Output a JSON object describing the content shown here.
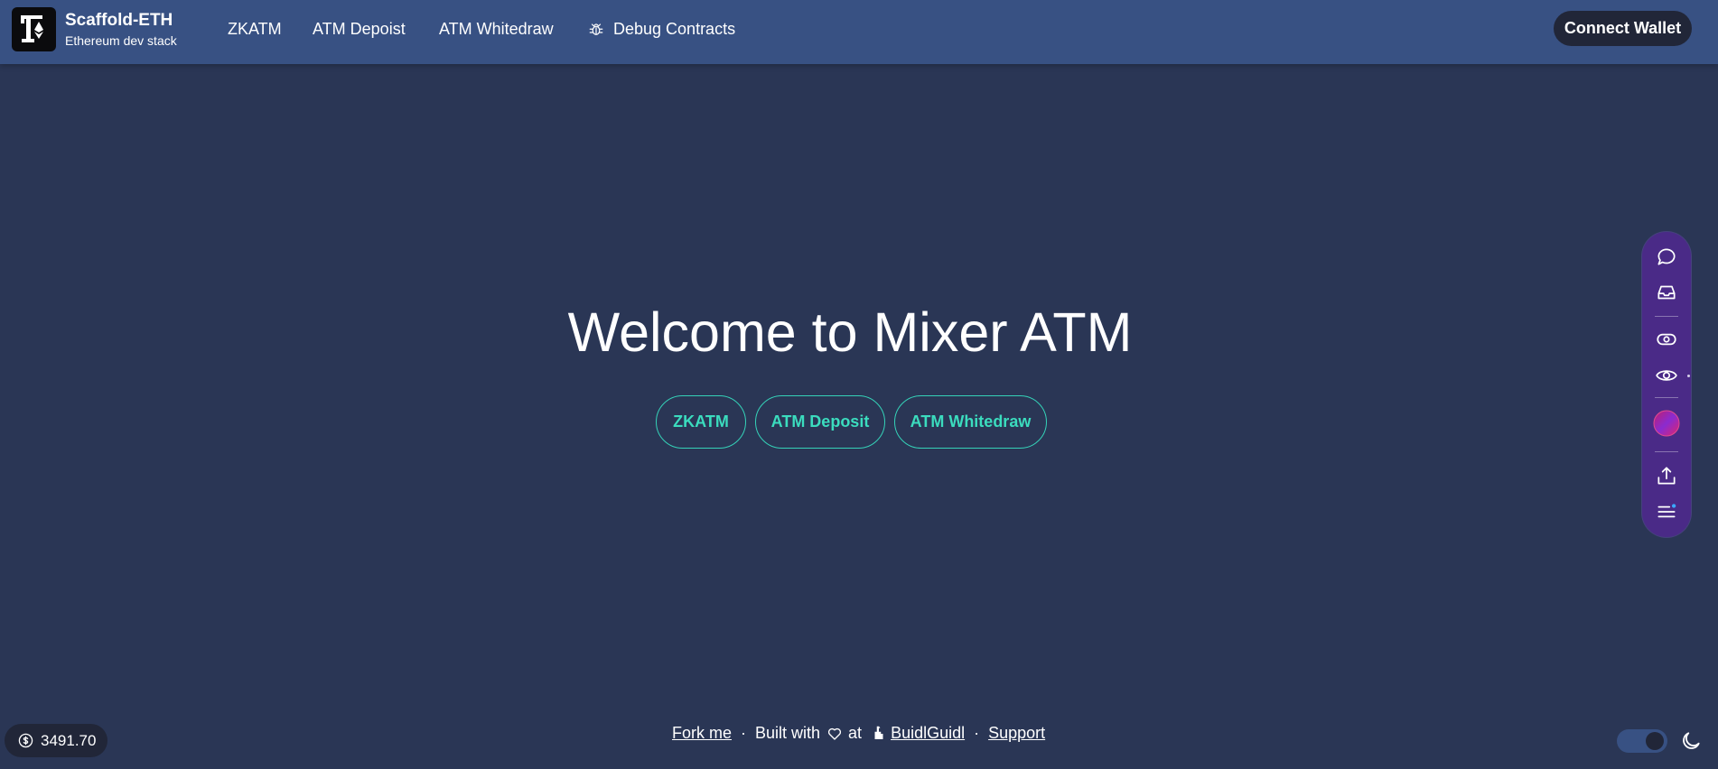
{
  "header": {
    "brand_title": "Scaffold-ETH",
    "brand_subtitle": "Ethereum dev stack",
    "nav": [
      {
        "label": "ZKATM"
      },
      {
        "label": "ATM Depoist"
      },
      {
        "label": "ATM Whitedraw"
      },
      {
        "label": "Debug Contracts",
        "icon": "bug-icon"
      }
    ],
    "connect_label": "Connect Wallet"
  },
  "hero": {
    "title": "Welcome to Mixer ATM",
    "buttons": [
      {
        "label": "ZKATM"
      },
      {
        "label": "ATM Deposit"
      },
      {
        "label": "ATM Whitedraw"
      }
    ]
  },
  "toolbar": {
    "icons": [
      "chat-icon",
      "inbox-icon",
      "eye-outline-icon",
      "eye-icon",
      "avatar",
      "share-icon",
      "menu-icon"
    ]
  },
  "footer": {
    "price": "3491.70",
    "fork_label": "Fork me",
    "built_with": "Built with",
    "at": "at",
    "buidlguidl_label": "BuidlGuidl",
    "support_label": "Support",
    "separator": "·"
  },
  "colors": {
    "background": "#2a3655",
    "header": "#385183",
    "accent": "#35d2b8",
    "toolbar": "#4a2a87",
    "dark_chip": "#212638"
  }
}
